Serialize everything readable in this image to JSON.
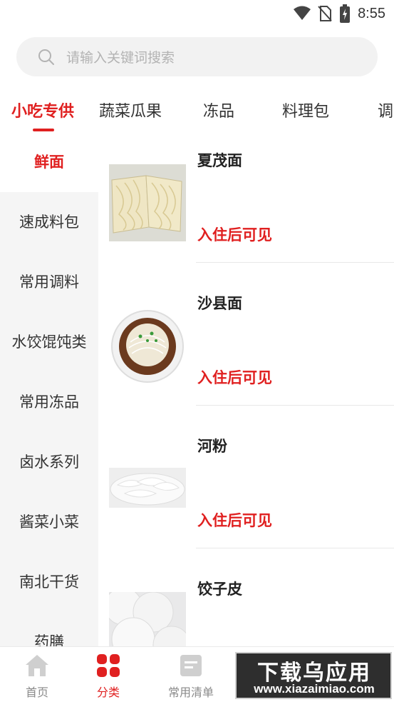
{
  "status_bar": {
    "time": "8:55"
  },
  "search": {
    "placeholder": "请输入关键词搜索"
  },
  "category_tabs": [
    "小吃专供",
    "蔬菜瓜果",
    "冻品",
    "料理包",
    "调"
  ],
  "sidebar": {
    "items": [
      "鲜面",
      "速成料包",
      "常用调料",
      "水饺馄饨类",
      "常用冻品",
      "卤水系列",
      "酱菜小菜",
      "南北干货",
      "药膳"
    ],
    "active_index": 0
  },
  "products": [
    {
      "name": "夏茂面",
      "price_text": "入住后可见"
    },
    {
      "name": "沙县面",
      "price_text": "入住后可见"
    },
    {
      "name": "河粉",
      "price_text": "入住后可见"
    },
    {
      "name": "饺子皮",
      "price_text": ""
    }
  ],
  "bottom_nav": {
    "items": [
      {
        "label": "首页",
        "icon": "home-icon"
      },
      {
        "label": "分类",
        "icon": "category-grid-icon"
      },
      {
        "label": "常用清单",
        "icon": "list-document-icon"
      }
    ],
    "active_index": 1
  },
  "watermark": {
    "title": "下载乌应用",
    "url": "www.xiazaimiao.com"
  },
  "colors": {
    "accent": "#e02020",
    "sidebar_bg": "#f5f5f5",
    "search_bg": "#f2f2f2"
  }
}
